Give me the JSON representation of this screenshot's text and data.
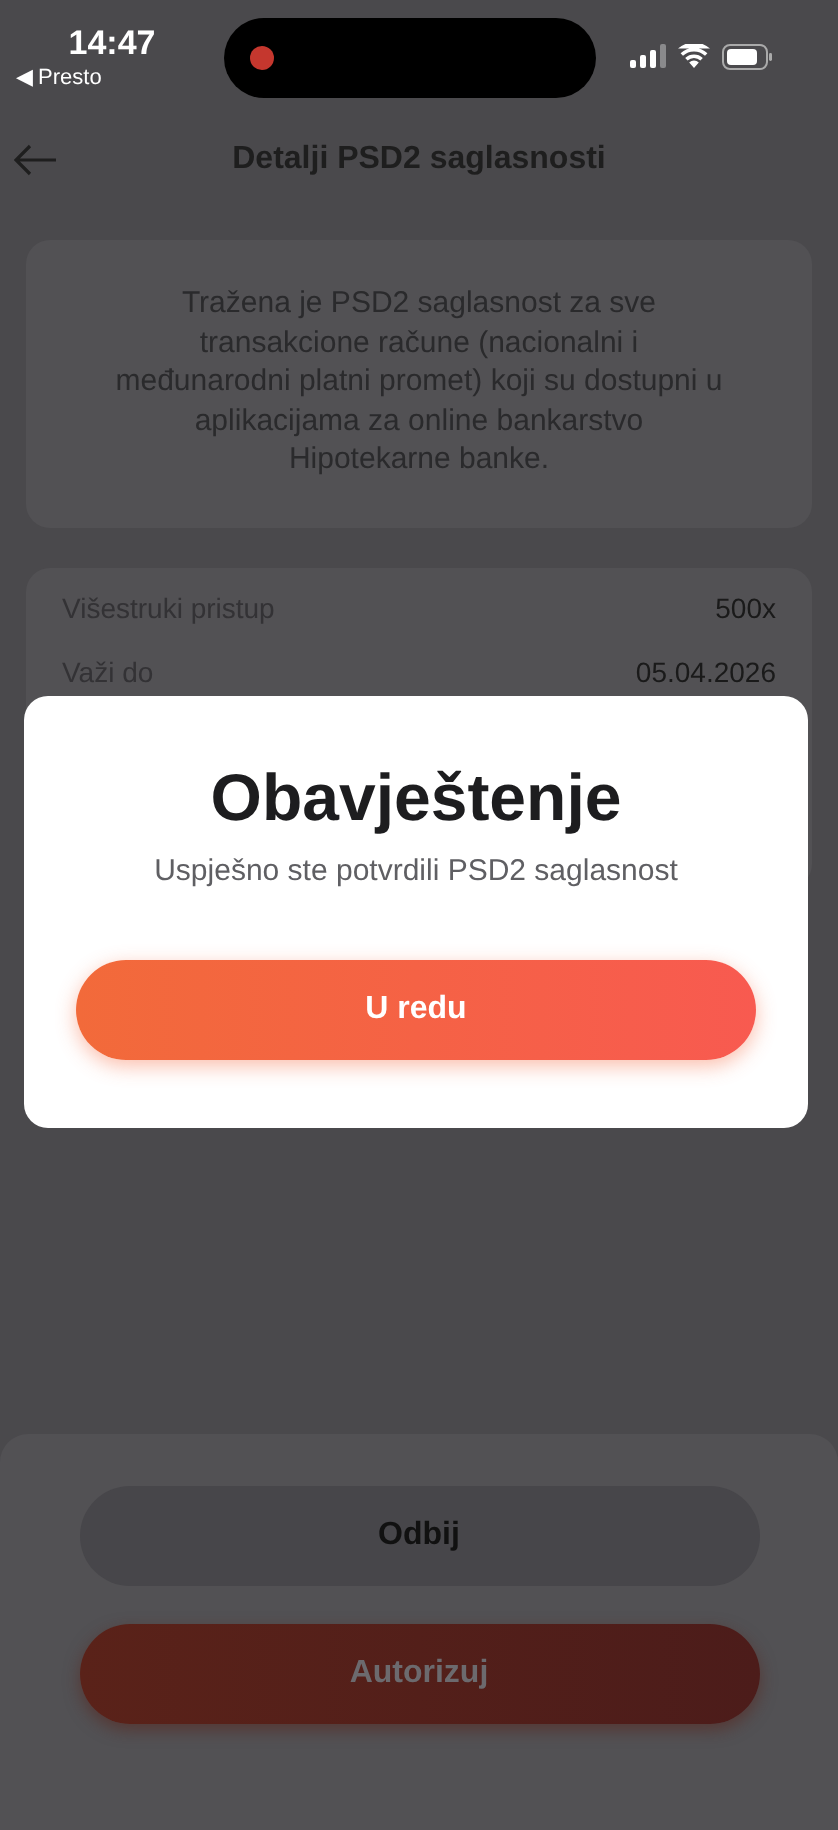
{
  "status_bar": {
    "time": "14:47",
    "back_app": "◀ Presto"
  },
  "header": {
    "title": "Detalji PSD2 saglasnosti"
  },
  "info": {
    "text": "Tražena je PSD2 saglasnost za sve transakcione račune (nacionalni i međunarodni platni promet) koji su dostupni u aplikacijama za online bankarstvo Hipotekarne banke."
  },
  "details": [
    {
      "label": "Višestruki pristup",
      "value": "500x"
    },
    {
      "label": "Važi do",
      "value": "05.04.2026"
    }
  ],
  "buttons": [
    {
      "label": "Odbij",
      "kind": "secondary"
    },
    {
      "label": "Autorizuj",
      "kind": "primary"
    }
  ],
  "dialog": {
    "title": "Obavještenje",
    "message": "Uspješno ste potvrdili PSD2 saglasnost",
    "button": "U redu"
  }
}
